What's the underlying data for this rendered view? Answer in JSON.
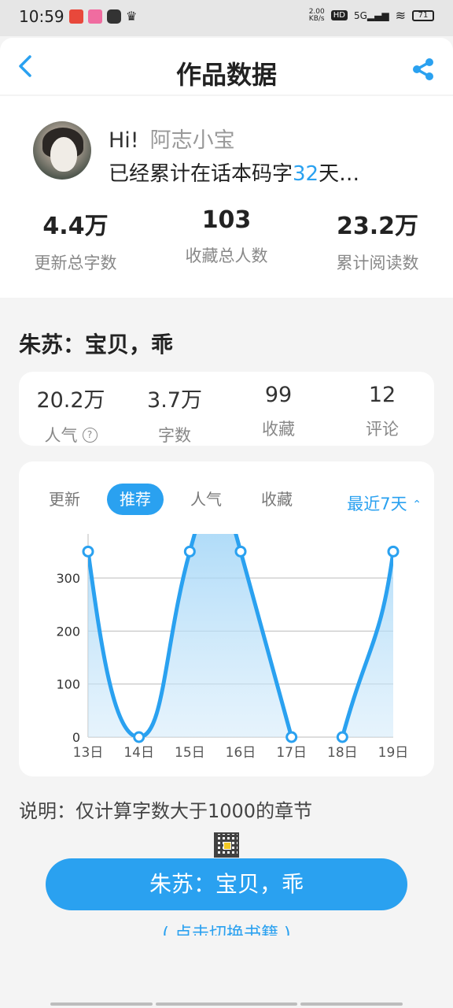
{
  "status_bar": {
    "time": "10:59",
    "net_speed_value": "2.00",
    "net_speed_unit": "KB/s",
    "hd": "HD",
    "network": "5G",
    "battery": "71"
  },
  "header": {
    "title": "作品数据",
    "back_icon": "chevron-left-icon",
    "share_icon": "share-icon"
  },
  "profile": {
    "greeting": "Hi!",
    "nickname": "阿志小宝",
    "days_prefix": "已经累计在话本码字",
    "days": "32",
    "days_suffix": "天…"
  },
  "totals": [
    {
      "value": "4.4万",
      "label": "更新总字数"
    },
    {
      "value": "103",
      "label": "收藏总人数"
    },
    {
      "value": "23.2万",
      "label": "累计阅读数"
    }
  ],
  "work": {
    "title": "朱苏：宝贝，乖",
    "stats": [
      {
        "value": "20.2万",
        "label": "人气"
      },
      {
        "value": "3.7万",
        "label": "字数"
      },
      {
        "value": "99",
        "label": "收藏"
      },
      {
        "value": "12",
        "label": "评论"
      }
    ],
    "help_icon_glyph": "?"
  },
  "chart_tabs": [
    "更新",
    "推荐",
    "人气",
    "收藏"
  ],
  "active_tab": "推荐",
  "range_label": "最近7天",
  "range_icon": "sort-arrows-icon",
  "colors": {
    "accent": "#2aa1f0"
  },
  "chart_data": {
    "type": "area",
    "x": [
      "13日",
      "14日",
      "15日",
      "16日",
      "17日",
      "18日",
      "19日"
    ],
    "series": [
      {
        "values": [
          350,
          0,
          350,
          350,
          0,
          0,
          350
        ]
      }
    ],
    "ylim": [
      0,
      350
    ],
    "yticks": [
      0,
      100,
      200,
      300
    ],
    "grid": true,
    "smooth": true
  },
  "note": "说明：仅计算字数大于1000的章节",
  "switch_button": "朱苏：宝贝，乖",
  "switch_link": "( 点击切换书籍 )"
}
